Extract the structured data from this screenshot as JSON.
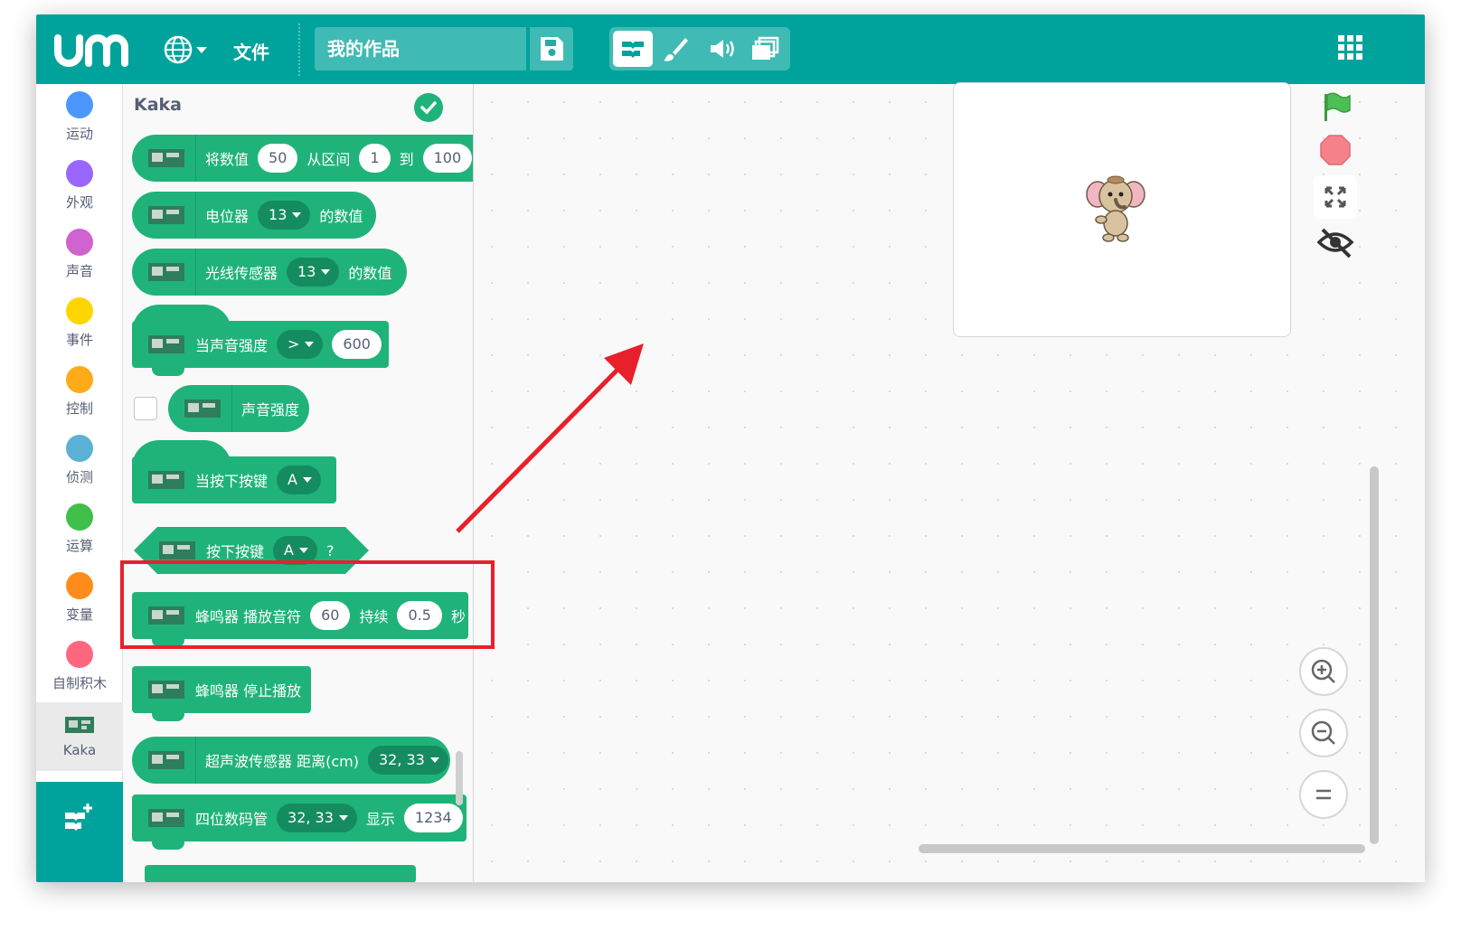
{
  "topbar": {
    "file_menu": "文件",
    "project_title": "我的作品"
  },
  "categories": [
    {
      "label": "运动",
      "color": "#4c97ff"
    },
    {
      "label": "外观",
      "color": "#9966ff"
    },
    {
      "label": "声音",
      "color": "#cf63cf"
    },
    {
      "label": "事件",
      "color": "#ffd500"
    },
    {
      "label": "控制",
      "color": "#ffab19"
    },
    {
      "label": "侦测",
      "color": "#5cb1d6"
    },
    {
      "label": "运算",
      "color": "#40bf4a"
    },
    {
      "label": "变量",
      "color": "#ff8c1a"
    },
    {
      "label": "自制积木",
      "color": "#ff6680"
    },
    {
      "label": "Kaka",
      "color": "#1fb37a"
    }
  ],
  "palette": {
    "title": "Kaka",
    "blocks": {
      "map": {
        "t1": "将数值",
        "v1": "50",
        "t2": "从区间",
        "v2": "1",
        "t3": "到",
        "v3": "100"
      },
      "pot": {
        "t1": "电位器",
        "d1": "13",
        "t2": "的数值"
      },
      "light": {
        "t1": "光线传感器",
        "d1": "13",
        "t2": "的数值"
      },
      "when_sound": {
        "t1": "当声音强度",
        "d1": ">",
        "v1": "600"
      },
      "sound_level": {
        "t1": "声音强度"
      },
      "when_key": {
        "t1": "当按下按键",
        "d1": "A"
      },
      "key_pressed": {
        "t1": "按下按键",
        "d1": "A",
        "t2": "?"
      },
      "buzzer_play": {
        "t1": "蜂鸣器 播放音符",
        "v1": "60",
        "t2": "持续",
        "v2": "0.5",
        "t3": "秒"
      },
      "buzzer_stop": {
        "t1": "蜂鸣器 停止播放"
      },
      "ultrasonic": {
        "t1": "超声波传感器 距离(cm)",
        "d1": "32, 33"
      },
      "seg7": {
        "t1": "四位数码管",
        "d1": "32, 33",
        "t2": "显示",
        "v1": "1234"
      }
    }
  },
  "colors": {
    "brand": "#00a39b",
    "block": "#1fb37a",
    "highlight": "#e8202b"
  }
}
